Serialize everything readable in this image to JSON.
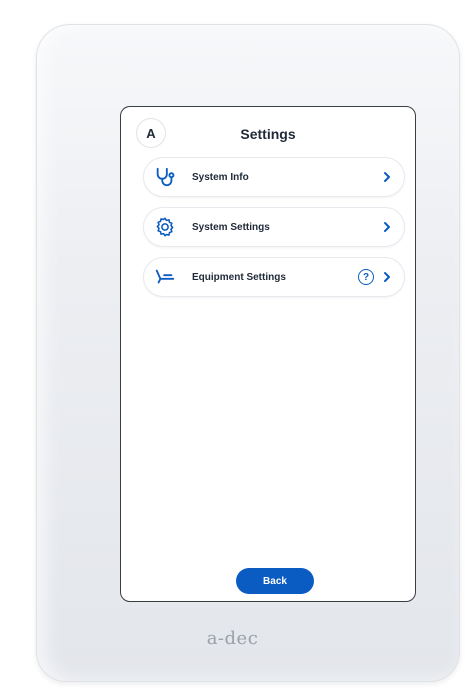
{
  "screen": {
    "avatar_letter": "A",
    "title": "Settings",
    "menu": [
      {
        "label": "System Info",
        "icon": "stethoscope-icon",
        "help": false
      },
      {
        "label": "System Settings",
        "icon": "gear-icon",
        "help": false
      },
      {
        "label": "Equipment Settings",
        "icon": "dental-chair-icon",
        "help": true
      }
    ],
    "help_symbol": "?",
    "back_label": "Back"
  },
  "device": {
    "logo_text": "a-dec"
  },
  "colors": {
    "accent": "#0b5cc2",
    "text": "#1f2937",
    "bezel": "#eceef2"
  }
}
